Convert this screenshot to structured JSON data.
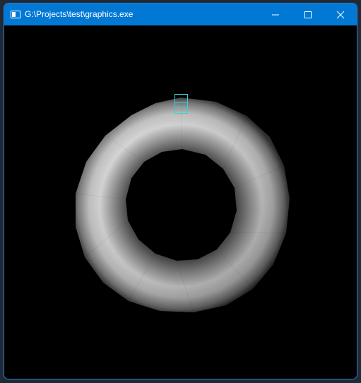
{
  "window": {
    "title": "G:\\Projects\\test\\graphics.exe"
  },
  "titlebar": {
    "icons": {
      "app": "window-app-icon",
      "minimize": "minimize-icon",
      "maximize": "maximize-icon",
      "close": "close-icon"
    }
  },
  "scene": {
    "object": "torus",
    "shading": "grayscale",
    "background_color": "#000000",
    "selection_marker_color": "#2fd6d6"
  }
}
